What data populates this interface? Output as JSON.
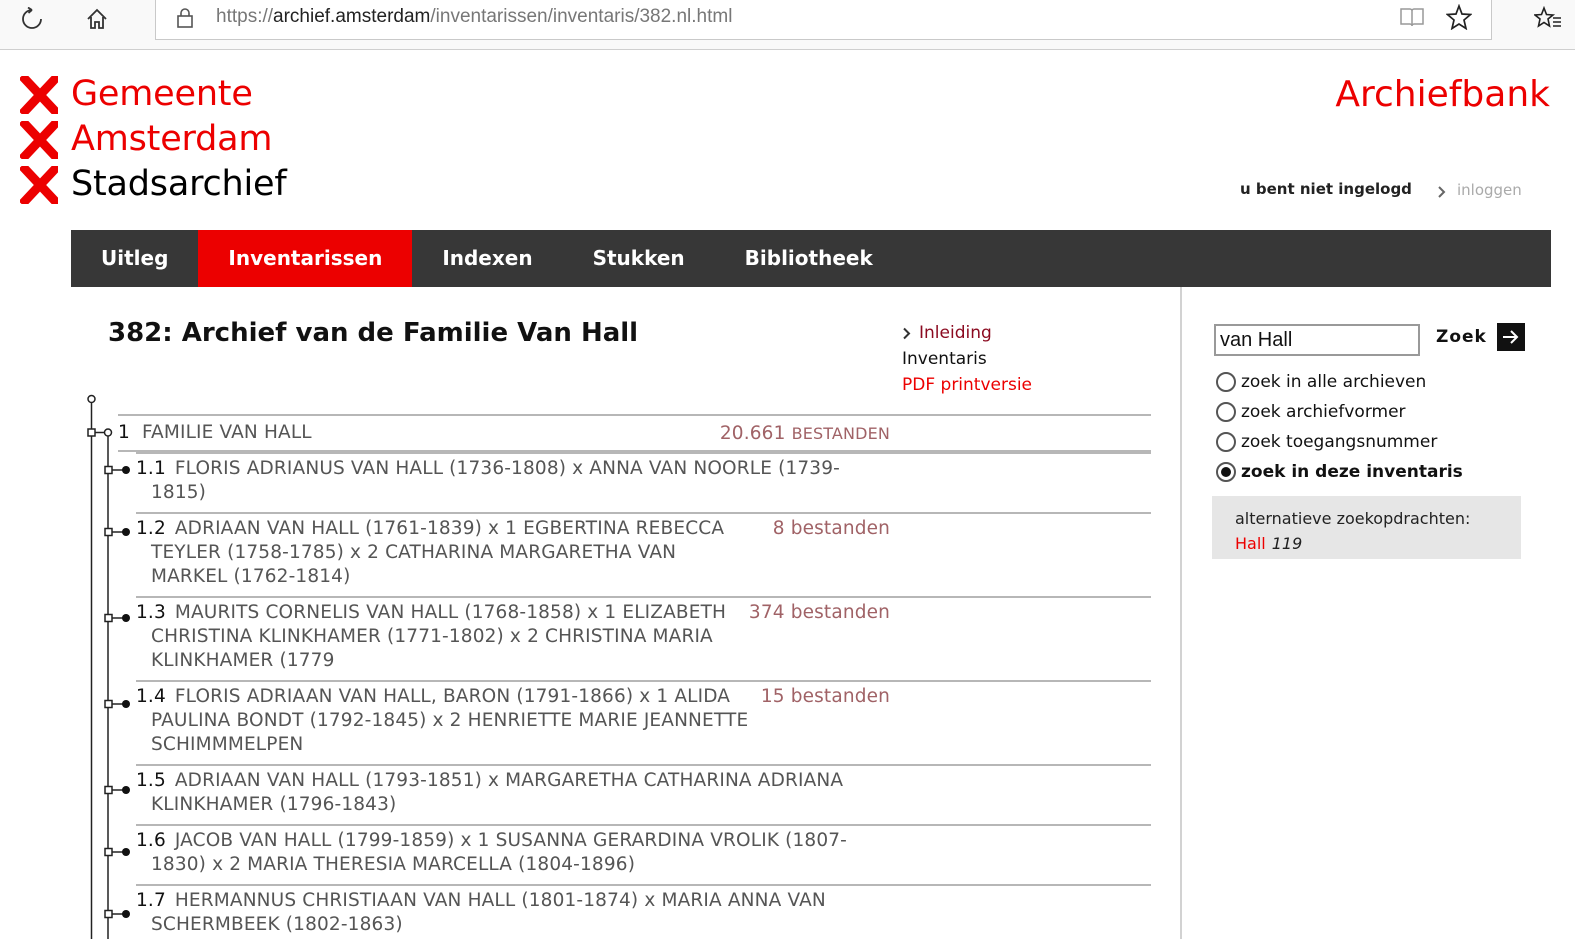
{
  "browser": {
    "url_prefix": "https://",
    "url_host": "archief.amsterdam",
    "url_path": "/inventarissen/inventaris/382.nl.html"
  },
  "header": {
    "logo_lines": [
      "Gemeente",
      "Amsterdam",
      "Stadsarchief"
    ],
    "brand": "Archiefbank",
    "login_status": "u bent niet ingelogd",
    "login_link": "inloggen",
    "logo_color": "#ec0000"
  },
  "nav": {
    "tabs": [
      {
        "label": "Uitleg",
        "active": false
      },
      {
        "label": "Inventarissen",
        "active": true
      },
      {
        "label": "Indexen",
        "active": false
      },
      {
        "label": "Stukken",
        "active": false
      },
      {
        "label": "Bibliotheek",
        "active": false
      }
    ]
  },
  "main": {
    "title": "382: Archief van de Familie Van Hall",
    "links": {
      "inleiding": "Inleiding",
      "inventaris": "Inventaris",
      "pdf": "PDF printversie"
    },
    "tree": {
      "root": {
        "number": "1",
        "label": "FAMILIE VAN HALL",
        "count_num": "20.661",
        "count_label": "BESTANDEN"
      },
      "children": [
        {
          "number": "1.1",
          "label": "FLORIS ADRIANUS VAN HALL (1736-1808) x ANNA VAN NOORLE (1739-1815)",
          "count": ""
        },
        {
          "number": "1.2",
          "label": "ADRIAAN VAN HALL (1761-1839) x 1 EGBERTINA REBECCA TEYLER (1758-1785) x 2 CATHARINA MARGARETHA VAN MARKEL (1762-1814)",
          "count": "8 bestanden"
        },
        {
          "number": "1.3",
          "label": "MAURITS CORNELIS VAN HALL (1768-1858) x 1 ELIZABETH CHRISTINA KLINKHAMER (1771-1802) x 2 CHRISTINA MARIA KLINKHAMER (1779",
          "count": "374 bestanden"
        },
        {
          "number": "1.4",
          "label": "FLORIS ADRIAAN VAN HALL, BARON (1791-1866) x 1 ALIDA PAULINA BONDT (1792-1845) x 2 HENRIETTE MARIE JEANNETTE SCHIMMMELPEN",
          "count": "15 bestanden"
        },
        {
          "number": "1.5",
          "label": "ADRIAAN VAN HALL (1793-1851) x MARGARETHA CATHARINA ADRIANA KLINKHAMER (1796-1843)",
          "count": ""
        },
        {
          "number": "1.6",
          "label": "JACOB VAN HALL (1799-1859) x 1 SUSANNA GERARDINA VROLIK (1807-1830) x 2 MARIA THERESIA MARCELLA (1804-1896)",
          "count": ""
        },
        {
          "number": "1.7",
          "label": "HERMANNUS CHRISTIAAN VAN HALL (1801-1874) x MARIA ANNA VAN SCHERMBEEK (1802-1863)",
          "count": ""
        }
      ]
    }
  },
  "sidebar": {
    "search_value": "van Hall",
    "search_button": "Zoek",
    "radios": [
      {
        "label": "zoek in alle archieven",
        "checked": false
      },
      {
        "label": "zoek archiefvormer",
        "checked": false
      },
      {
        "label": "zoek toegangsnummer",
        "checked": false
      },
      {
        "label": "zoek in deze inventaris",
        "checked": true
      }
    ],
    "alternatives": {
      "heading": "alternatieve zoekopdrachten:",
      "link": "Hall",
      "count": "119"
    }
  }
}
